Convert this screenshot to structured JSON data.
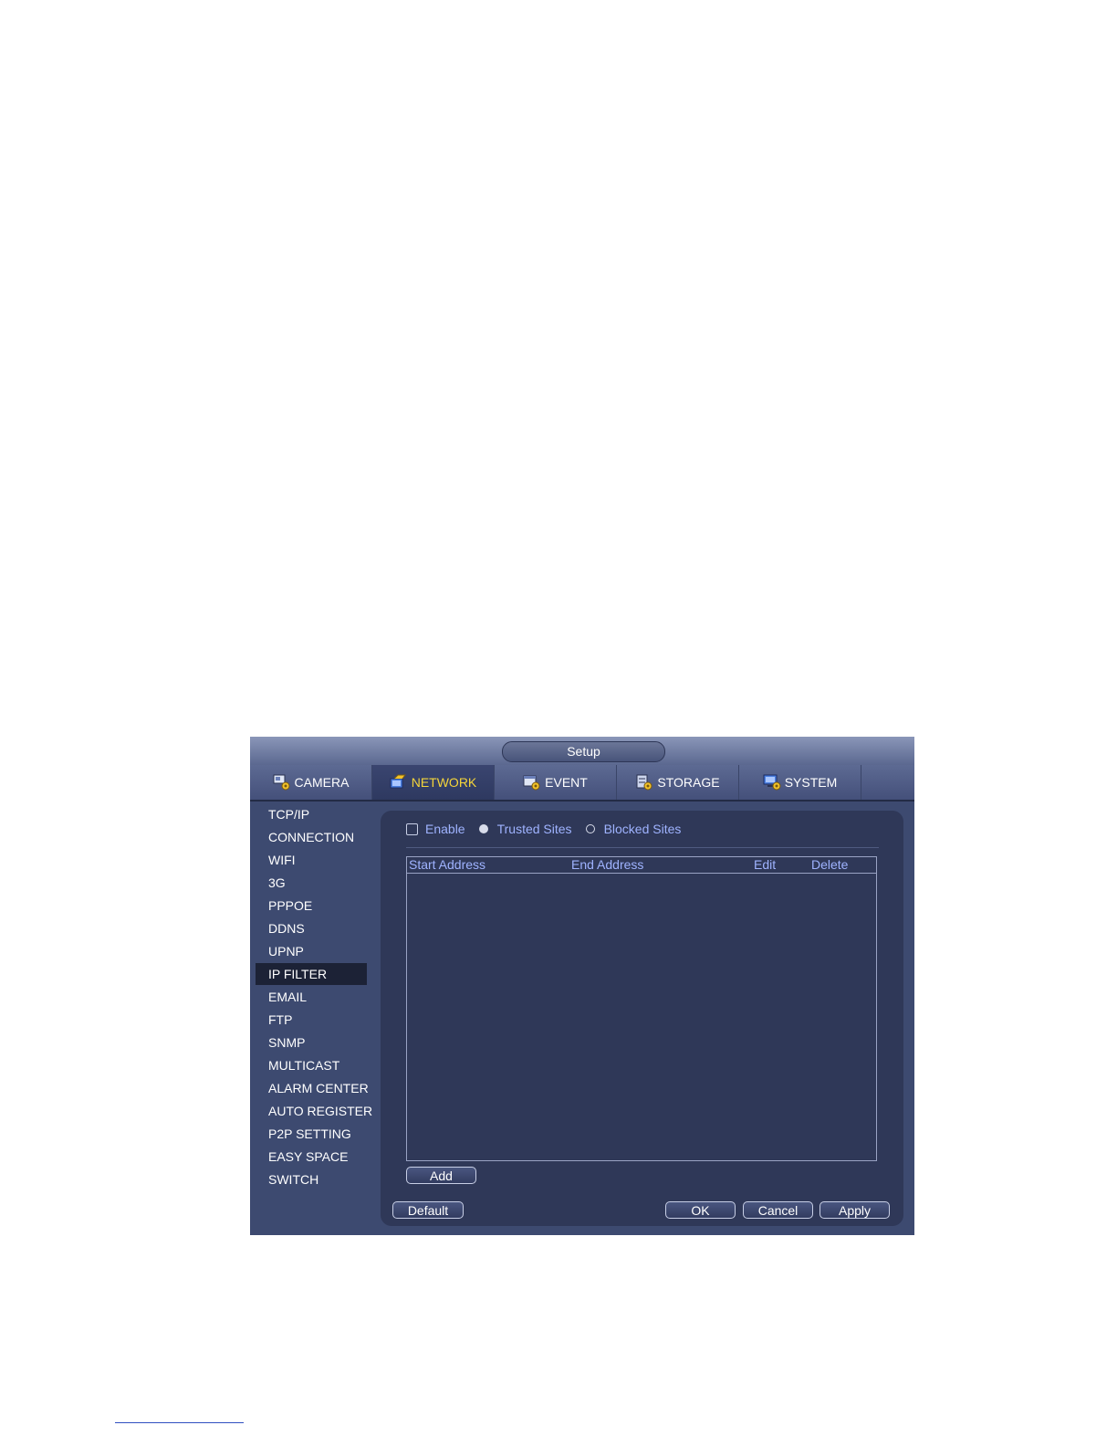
{
  "window": {
    "title": "Setup"
  },
  "tabs": [
    {
      "label": "CAMERA",
      "icon": "camera-settings-icon"
    },
    {
      "label": "NETWORK",
      "icon": "network-settings-icon",
      "active": true
    },
    {
      "label": "EVENT",
      "icon": "event-settings-icon"
    },
    {
      "label": "STORAGE",
      "icon": "storage-settings-icon"
    },
    {
      "label": "SYSTEM",
      "icon": "system-settings-icon"
    }
  ],
  "sidebar": {
    "items": [
      {
        "label": "TCP/IP"
      },
      {
        "label": "CONNECTION"
      },
      {
        "label": "WIFI"
      },
      {
        "label": "3G"
      },
      {
        "label": "PPPOE"
      },
      {
        "label": "DDNS"
      },
      {
        "label": "UPNP"
      },
      {
        "label": "IP FILTER",
        "active": true
      },
      {
        "label": "EMAIL"
      },
      {
        "label": "FTP"
      },
      {
        "label": "SNMP"
      },
      {
        "label": "MULTICAST"
      },
      {
        "label": "ALARM CENTER"
      },
      {
        "label": "AUTO REGISTER"
      },
      {
        "label": "P2P SETTING"
      },
      {
        "label": "EASY SPACE"
      },
      {
        "label": "SWITCH"
      }
    ]
  },
  "ipfilter": {
    "enable_label": "Enable",
    "enable_checked": false,
    "trusted_label": "Trusted Sites",
    "blocked_label": "Blocked Sites",
    "selected_mode": "trusted",
    "columns": {
      "start": "Start Address",
      "end": "End Address",
      "edit": "Edit",
      "delete": "Delete"
    },
    "rows": []
  },
  "buttons": {
    "add": "Add",
    "default": "Default",
    "ok": "OK",
    "cancel": "Cancel",
    "apply": "Apply"
  },
  "colors": {
    "accent_active_tab": "#f5d53a",
    "label_blue": "#9fb3ff",
    "window_bg": "#3d4a70",
    "panel_bg": "#2f3858"
  }
}
